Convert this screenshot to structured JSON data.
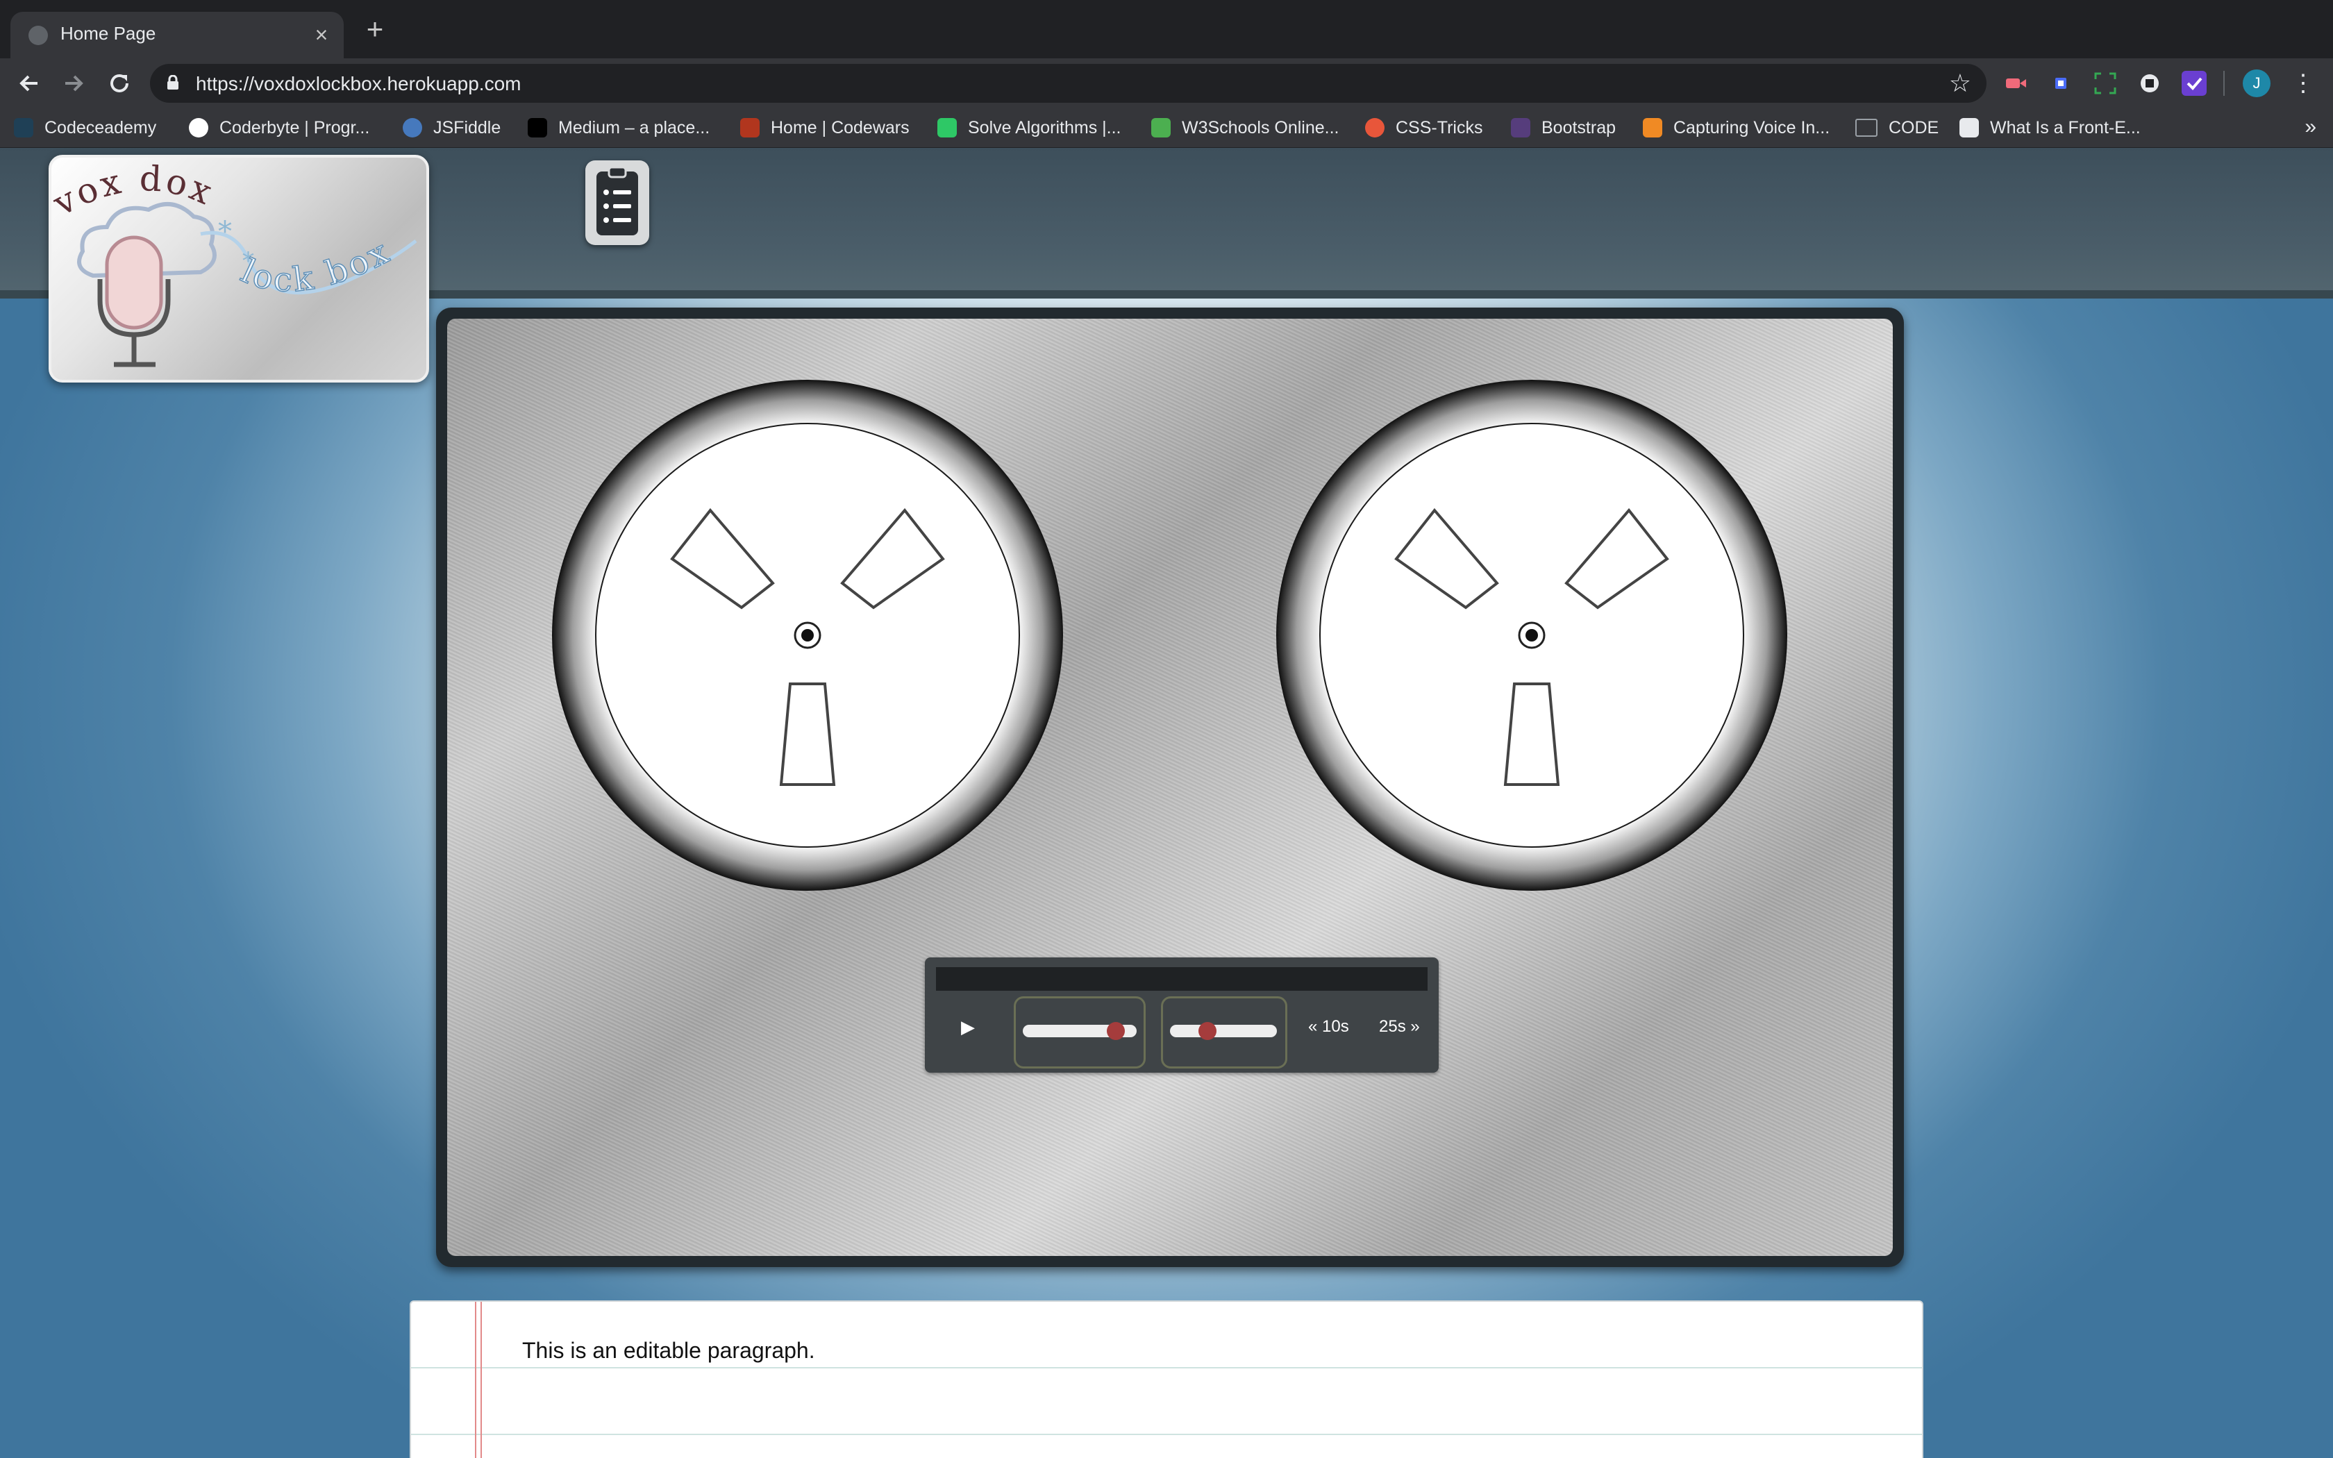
{
  "browser": {
    "tab_title": "Home Page",
    "new_tab_symbol": "+",
    "close_symbol": "×",
    "url": "https://voxdoxlockbox.herokuapp.com",
    "profile_initial": "J",
    "bookmarks": [
      {
        "label": "Codeceademy",
        "icon": "codecademy-icon",
        "color": "#1f4056"
      },
      {
        "label": "Coderbyte | Progr...",
        "icon": "coderbyte-icon",
        "color": "#ffffff"
      },
      {
        "label": "JSFiddle",
        "icon": "jsfiddle-icon",
        "color": "#4679bd"
      },
      {
        "label": "Medium – a place...",
        "icon": "medium-icon",
        "color": "#000000"
      },
      {
        "label": "Home | Codewars",
        "icon": "codewars-icon",
        "color": "#b1361e"
      },
      {
        "label": "Solve Algorithms |...",
        "icon": "hackerrank-icon",
        "color": "#2ec866"
      },
      {
        "label": "W3Schools Online...",
        "icon": "w3schools-icon",
        "color": "#4caf50"
      },
      {
        "label": "CSS-Tricks",
        "icon": "css-tricks-icon",
        "color": "#e8563a"
      },
      {
        "label": "Bootstrap",
        "icon": "bootstrap-icon",
        "color": "#563d7c"
      },
      {
        "label": "Capturing Voice In...",
        "icon": "cube-icon",
        "color": "#f08a24"
      },
      {
        "label": "CODE",
        "icon": "folder-icon",
        "color": "#9aa0a6"
      },
      {
        "label": "What Is a Front-E...",
        "icon": "book-icon",
        "color": "#e8eaed"
      }
    ],
    "more_bookmarks": "»"
  },
  "app": {
    "logo_text_top": "vox dox",
    "logo_text_bottom": "lock box",
    "transport": {
      "play_symbol": "▶",
      "progress_level": 0.82,
      "volume_level": 0.35,
      "rewind_label": "« 10s",
      "forward_label": "25s »"
    },
    "editable_paragraph": "This is an editable paragraph."
  },
  "colors": {
    "page_bg": "#4a7ea3",
    "header_bg": "#455a64",
    "slider_thumb": "#a53c3c",
    "paper_margin": "#e28a8a"
  }
}
